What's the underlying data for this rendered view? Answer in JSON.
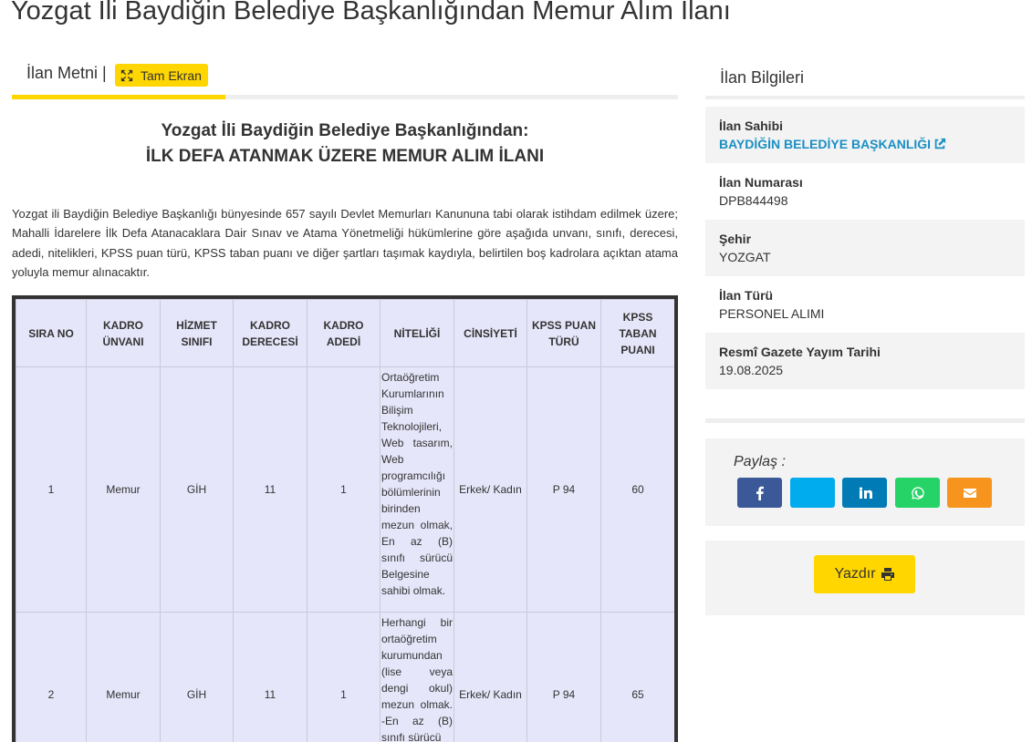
{
  "page": {
    "title": "Yozgat İli Baydiğin Belediye Başkanlığından Memur Alım İlanı"
  },
  "tabs": {
    "label": "İlan Metni |",
    "fullscreen_label": "Tam Ekran"
  },
  "document": {
    "heading_line1": "Yozgat İli Baydiğin Belediye Başkanlığından:",
    "heading_line2": "İLK DEFA ATANMAK ÜZERE MEMUR ALIM İLANI",
    "intro": "Yozgat ili Baydiğin Belediye Başkanlığı bünyesinde 657 sayılı Devlet Memurları Kanununa tabi olarak istihdam edilmek üzere; Mahalli İdarelere İlk Defa Atanacaklara Dair Sınav ve Atama Yönetmeliği hükümlerine göre aşağıda unvanı, sınıfı, derecesi, adedi, nitelikleri, KPSS puan türü, KPSS taban puanı ve diğer şartları taşımak kaydıyla, belirtilen boş kadrolara açıktan atama yoluyla memur alınacaktır."
  },
  "table": {
    "headers": [
      "SIRA NO",
      "KADRO ÜNVANI",
      "HİZMET SINIFI",
      "KADRO DERECESİ",
      "KADRO ADEDİ",
      "NİTELİĞİ",
      "CİNSİYETİ",
      "KPSS PUAN TÜRÜ",
      "KPSS TABAN PUANI"
    ],
    "rows": [
      {
        "sira": "1",
        "unvan": "Memur",
        "sinif": "GİH",
        "derece": "11",
        "adet": "1",
        "nitelik": "Ortaöğretim Kurumlarının Bilişim Teknolojileri, Web tasarım, Web programcılığı bölümlerinin birinden mezun olmak, En az (B) sınıfı sürücü Belgesine sahibi olmak.",
        "cinsiyet": "Erkek/ Kadın",
        "puan_turu": "P 94",
        "taban": "60"
      },
      {
        "sira": "2",
        "unvan": "Memur",
        "sinif": "GİH",
        "derece": "11",
        "adet": "1",
        "nitelik": "Herhangi bir ortaöğretim kurumundan (lise veya dengi okul) mezun olmak. -En az (B) sınıfı sürücü",
        "cinsiyet": "Erkek/ Kadın",
        "puan_turu": "P 94",
        "taban": "65"
      }
    ]
  },
  "sidebar": {
    "title": "İlan Bilgileri",
    "owner_label": "İlan Sahibi",
    "owner_value": "BAYDİĞİN BELEDİYE BAŞKANLIĞI",
    "number_label": "İlan Numarası",
    "number_value": "DPB844498",
    "city_label": "Şehir",
    "city_value": "YOZGAT",
    "type_label": "İlan Türü",
    "type_value": "PERSONEL ALIMI",
    "gazette_label": "Resmî Gazete Yayım Tarihi",
    "gazette_value": "19.08.2025",
    "share_label": "Paylaş :",
    "print_label": "Yazdır"
  },
  "share_buttons": [
    {
      "icon": "facebook-icon",
      "color": "#3b5998"
    },
    {
      "icon": "twitter-icon",
      "color": "#00aced"
    },
    {
      "icon": "linkedin-icon",
      "color": "#007bb6"
    },
    {
      "icon": "whatsapp-icon",
      "color": "#25d366"
    },
    {
      "icon": "envelope-icon",
      "color": "#f7941d"
    }
  ],
  "colors": {
    "accent": "#ffd600",
    "link": "#1a8fc4",
    "table_bg": "#e6e6fa",
    "panel_bg": "#f3f3f3"
  }
}
